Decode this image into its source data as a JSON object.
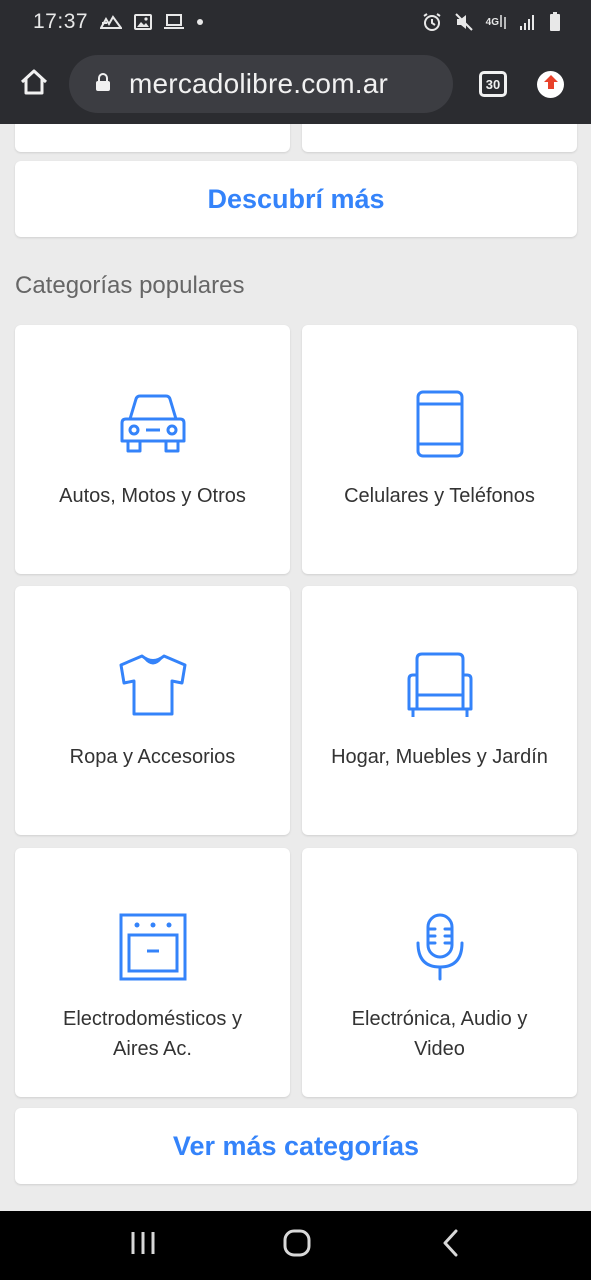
{
  "status_bar": {
    "time": "17:37",
    "network_label_top": "4G",
    "icons": [
      "mountain-icon",
      "image-icon",
      "laptop-icon",
      "dot-icon",
      "alarm-icon",
      "mute-icon",
      "network-icon",
      "signal-icon",
      "battery-icon"
    ]
  },
  "browser": {
    "url": "mercadolibre.com.ar",
    "tab_count": "30",
    "icons": [
      "home-icon",
      "lock-icon",
      "tabs-icon",
      "update-icon"
    ]
  },
  "page": {
    "discover_more": "Descubrí más",
    "section_title": "Categorías populares",
    "categories": [
      {
        "label": "Autos, Motos y Otros",
        "icon": "car-icon"
      },
      {
        "label": "Celulares y Teléfonos",
        "icon": "phone-icon"
      },
      {
        "label": "Ropa y Accesorios",
        "icon": "tshirt-icon"
      },
      {
        "label": "Hogar, Muebles y Jardín",
        "icon": "armchair-icon"
      },
      {
        "label": "Electrodomésticos y Aires Ac.",
        "icon": "oven-icon"
      },
      {
        "label": "Electrónica, Audio y Video",
        "icon": "microphone-icon"
      }
    ],
    "see_more_categories": "Ver más categorías"
  },
  "colors": {
    "accent": "#3483fa",
    "background": "#ebebeb",
    "chrome": "#2b2c30",
    "update_red": "#e8412a"
  },
  "nav_bar": {
    "icons": [
      "recents-icon",
      "home-nav-icon",
      "back-icon"
    ]
  }
}
